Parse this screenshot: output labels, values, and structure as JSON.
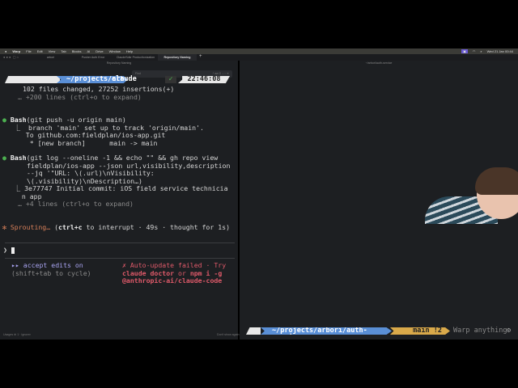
{
  "menubar": {
    "items": [
      "Warp",
      "File",
      "Edit",
      "View",
      "Tab",
      "Blocks",
      "AI",
      "Drive",
      "Window",
      "Help"
    ],
    "clock": "Wed 21 Jan 00:44"
  },
  "tabs": [
    {
      "label": "arbori"
    },
    {
      "label": "Pusher Auth Error"
    },
    {
      "label": "ClaudeSdkr Productionization"
    },
    {
      "label": "Repository Naming",
      "active": true
    }
  ],
  "left_pane": {
    "header": "Repository Naming",
    "find_placeholder": "Find",
    "prompt": {
      "path": "~/projects/arbori",
      "cmd": "claude",
      "status": "✓",
      "time": "22:46:08"
    },
    "lines": {
      "l1": "102 files changed, 27252 insertions(+)",
      "l2": "… +200 lines (ctrl+o to expand)",
      "b1_tool": "Bash",
      "b1_args": "(git push -u origin main)",
      "b1_o1": "⎿  branch 'main' set up to track 'origin/main'.",
      "b1_o2": "   To github.com:fieldplan/ios-app.git",
      "b1_o3": "    * [new branch]      main -> main",
      "b2_tool": "Bash",
      "b2_args": "(git log --oneline -1 && echo \"\" && gh repo view",
      "b2_a2": "fieldplan/ios-app --json url,visibility,description",
      "b2_a3": "--jq '\"URL: \\(.url)\\nVisibility:",
      "b2_a4": "\\(.visibility)\\nDescription…)",
      "b2_o1": "⎿ 3e77747 Initial commit: iOS field service technicia",
      "b2_o2": "  n app",
      "b2_o3": "… +4 lines (ctrl+o to expand)",
      "spin_icon": "✻",
      "spin_word": "Sprouting…",
      "spin_key": "ctrl+c",
      "spin_rest": " to interrupt · 49s · thought for 1s)",
      "input_prompt": "❯",
      "mode": "▸▸ accept edits on",
      "mode_hint": "(shift+tab to cycle)",
      "upd1": "✗ Auto-update failed · Try",
      "upd2a": "claude doctor",
      "upd2b": " or ",
      "upd2c": "npm i -g",
      "upd3": "@anthropic-ai/claude-code"
    },
    "status_left": "Usages ⊕ 1 · Ignorer",
    "status_right": "Don't show again"
  },
  "right_pane": {
    "header": "~/arbori/auth-service",
    "prompt": {
      "path": "~/projects/arbori/auth-service",
      "branch": "main !2",
      "placeholder": "Warp anything"
    }
  },
  "colors": {
    "path_blue": "#5a8fd6",
    "branch_gold": "#d9a94a",
    "accent_orange": "#d9805a"
  }
}
